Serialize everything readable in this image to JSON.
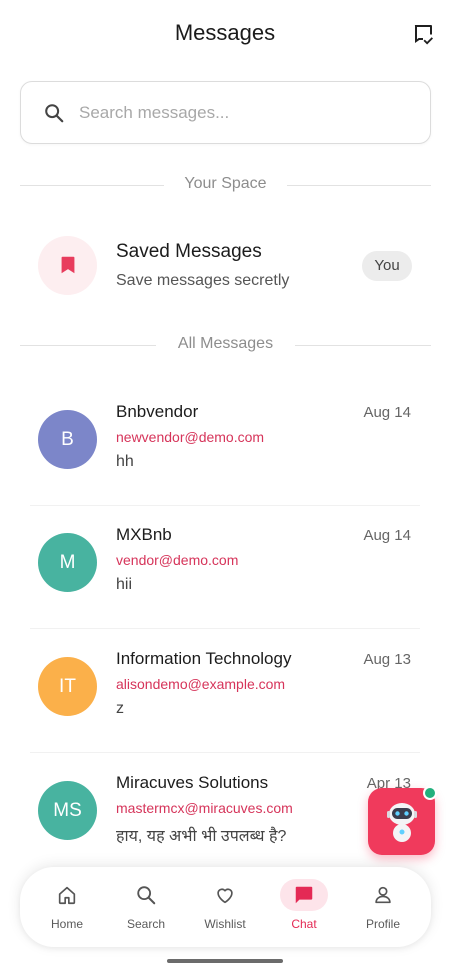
{
  "header": {
    "title": "Messages",
    "compose_icon": "chat-check-icon"
  },
  "search": {
    "placeholder": "Search messages...",
    "icon": "search-icon"
  },
  "sections": {
    "your_space": "Your Space",
    "all_messages": "All Messages"
  },
  "saved": {
    "title": "Saved Messages",
    "subtitle": "Save messages secretly",
    "badge": "You",
    "icon": "bookmark-icon"
  },
  "conversations": [
    {
      "initials": "B",
      "name": "Bnbvendor",
      "email": "newvendor@demo.com",
      "preview": "hh",
      "date": "Aug 14",
      "color": "#7c86c9"
    },
    {
      "initials": "M",
      "name": "MXBnb",
      "email": "vendor@demo.com",
      "preview": "hii",
      "date": "Aug 14",
      "color": "#48b3a0"
    },
    {
      "initials": "IT",
      "name": "Information Technology",
      "email": "alisondemo@example.com",
      "preview": "z",
      "date": "Aug 13",
      "color": "#fbb04a"
    },
    {
      "initials": "MS",
      "name": "Miracuves Solutions",
      "email": "mastermcx@miracuves.com",
      "preview": "हाय, यह अभी भी उपलब्ध है?",
      "date": "Apr 13",
      "color": "#48b3a0"
    }
  ],
  "fab": {
    "icon": "robot-icon",
    "status": "online"
  },
  "nav": {
    "items": [
      {
        "label": "Home",
        "icon": "home-icon"
      },
      {
        "label": "Search",
        "icon": "search-icon"
      },
      {
        "label": "Wishlist",
        "icon": "heart-icon"
      },
      {
        "label": "Chat",
        "icon": "chat-icon",
        "active": true
      },
      {
        "label": "Profile",
        "icon": "person-icon"
      }
    ]
  },
  "colors": {
    "accent": "#f03a5c",
    "email": "#d6345a",
    "online": "#22b07d"
  }
}
